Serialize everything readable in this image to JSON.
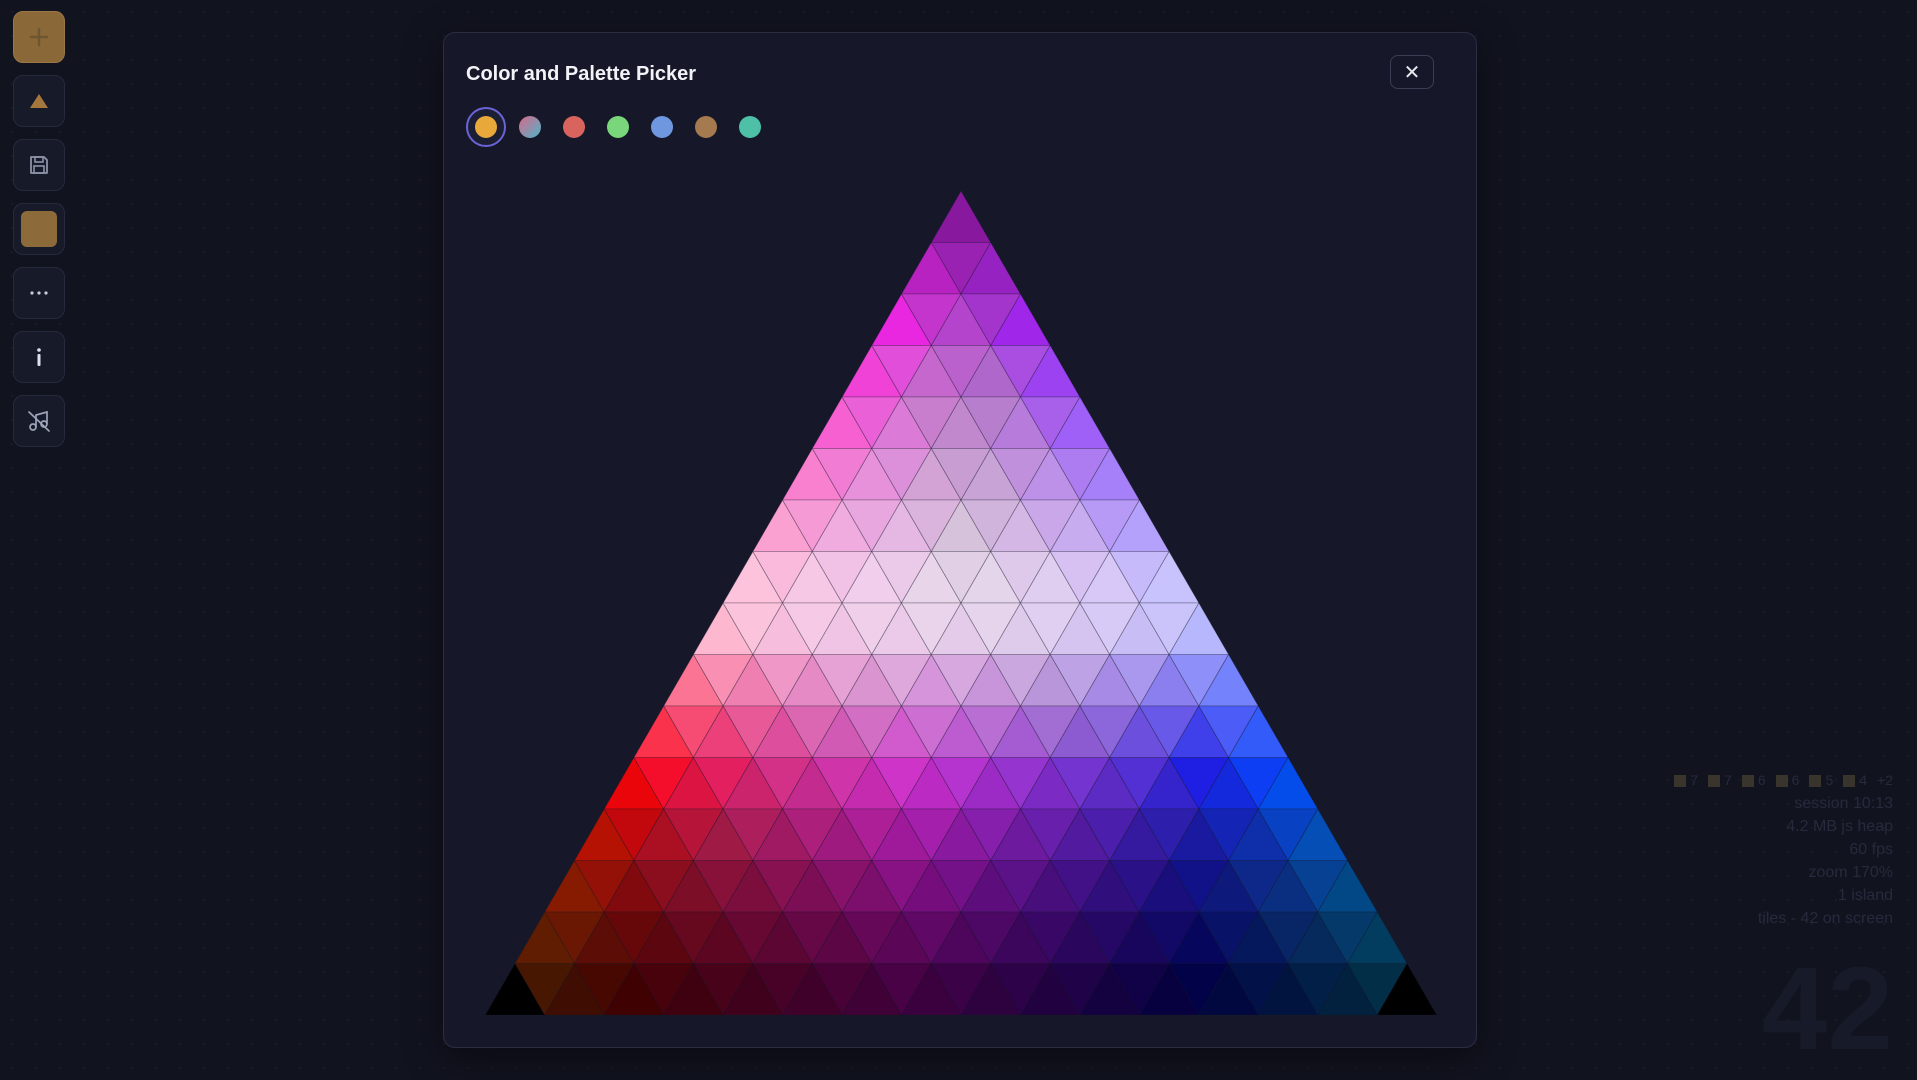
{
  "modal": {
    "title": "Color and Palette Picker",
    "close_label": "✕",
    "swatches": [
      {
        "name": "amber",
        "color": "#e8a93a",
        "selected": true
      },
      {
        "name": "gradient",
        "color": "linear-gradient(135deg,#d96a8a,#4fb3c9)",
        "selected": false
      },
      {
        "name": "red",
        "color": "#d9645e",
        "selected": false
      },
      {
        "name": "green",
        "color": "#7ad67a",
        "selected": false
      },
      {
        "name": "blue",
        "color": "#6f97e0",
        "selected": false
      },
      {
        "name": "brown",
        "color": "#a57a4e",
        "selected": false
      },
      {
        "name": "teal",
        "color": "#4fc0a8",
        "selected": false
      }
    ]
  },
  "picker": {
    "type": "triangular-color-grid",
    "rows": 16,
    "corners": {
      "top": "#5a0fb0",
      "bottom_left": "#000000",
      "bottom_right": "#000000"
    }
  },
  "toolbar": {
    "tools": [
      "plus-icon",
      "triangle-icon",
      "save-icon",
      "color-swatch",
      "more-icon",
      "info-icon",
      "no-music-icon"
    ],
    "current_color": "#8c6a3a"
  },
  "stats": {
    "legend": [
      {
        "label": "7"
      },
      {
        "label": "7"
      },
      {
        "label": "6"
      },
      {
        "label": "6"
      },
      {
        "label": "5"
      },
      {
        "label": "4"
      }
    ],
    "legend_more": "+2",
    "session": "session 10:13",
    "heap": "4.2 MB js heap",
    "fps": "60 fps",
    "zoom": "zoom 170%",
    "islands": "1 island",
    "tiles": "tiles - 42 on screen",
    "big_number": "42"
  }
}
